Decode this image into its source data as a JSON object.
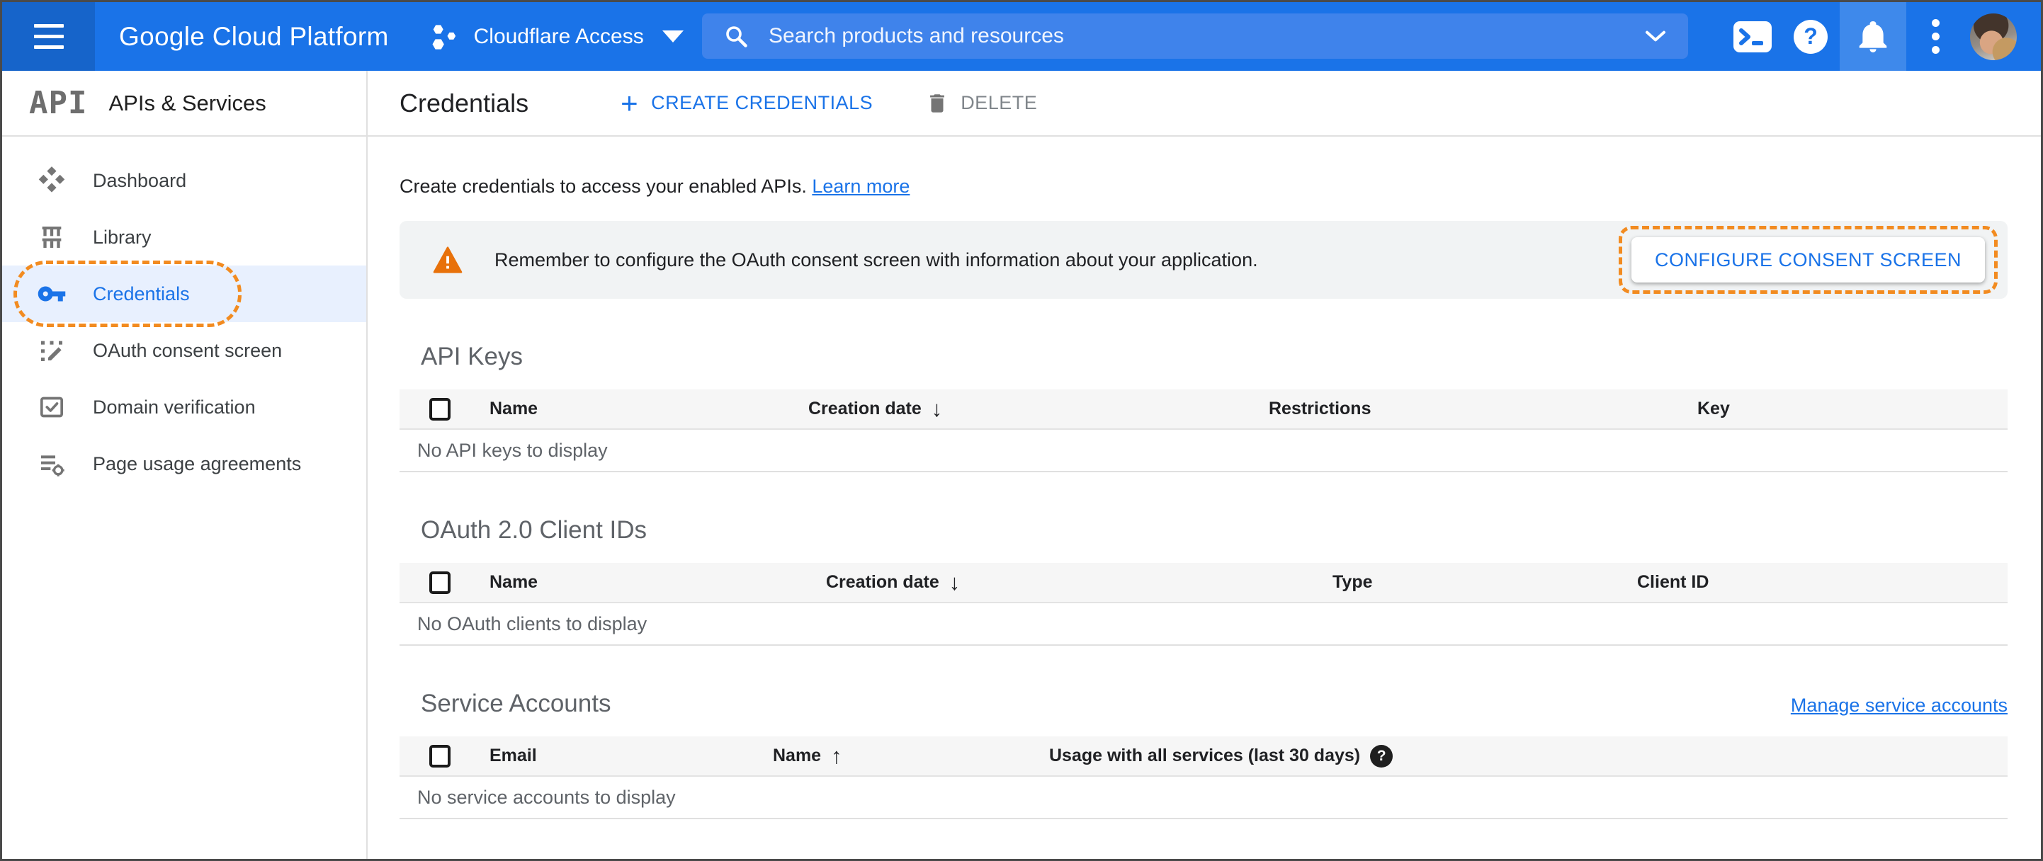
{
  "colors": {
    "topbar_blue": "#1a73e8",
    "search_blue": "#3f83eb",
    "accent_blue": "#1a73e8",
    "active_item_bg": "#e8f0fe",
    "highlight_dash_orange": "#f28b20",
    "warning_orange": "#e8710a",
    "banner_bg": "#f1f3f4",
    "table_header_bg": "#f6f6f6"
  },
  "topbar": {
    "product_name": "Google Cloud Platform",
    "project_name": "Cloudflare Access",
    "search_placeholder": "Search products and resources"
  },
  "sidebar": {
    "logo_text": "API",
    "title": "APIs & Services",
    "items": [
      {
        "label": "Dashboard"
      },
      {
        "label": "Library"
      },
      {
        "label": "Credentials",
        "active": true
      },
      {
        "label": "OAuth consent screen"
      },
      {
        "label": "Domain verification"
      },
      {
        "label": "Page usage agreements"
      }
    ]
  },
  "toolbar": {
    "title": "Credentials",
    "plus": "+",
    "create_label": "CREATE CREDENTIALS",
    "delete_label": "DELETE"
  },
  "main": {
    "intro_text": "Create credentials to access your enabled APIs.",
    "intro_link": "Learn more",
    "banner": {
      "text": "Remember to configure the OAuth consent screen with information about your application.",
      "button_label": "CONFIGURE CONSENT SCREEN"
    },
    "sections": [
      {
        "title": "API Keys",
        "columns": [
          "Name",
          "Creation date",
          "Restrictions",
          "Key"
        ],
        "sort_arrow": "↓",
        "empty": "No API keys to display"
      },
      {
        "title": "OAuth 2.0 Client IDs",
        "columns": [
          "Name",
          "Creation date",
          "Type",
          "Client ID"
        ],
        "sort_arrow": "↓",
        "empty": "No OAuth clients to display"
      },
      {
        "title": "Service Accounts",
        "link": "Manage service accounts",
        "columns": [
          "Email",
          "Name",
          "Usage with all services (last 30 days)"
        ],
        "sort_arrow": "↑",
        "help_icon": "?",
        "empty": "No service accounts to display"
      }
    ]
  }
}
